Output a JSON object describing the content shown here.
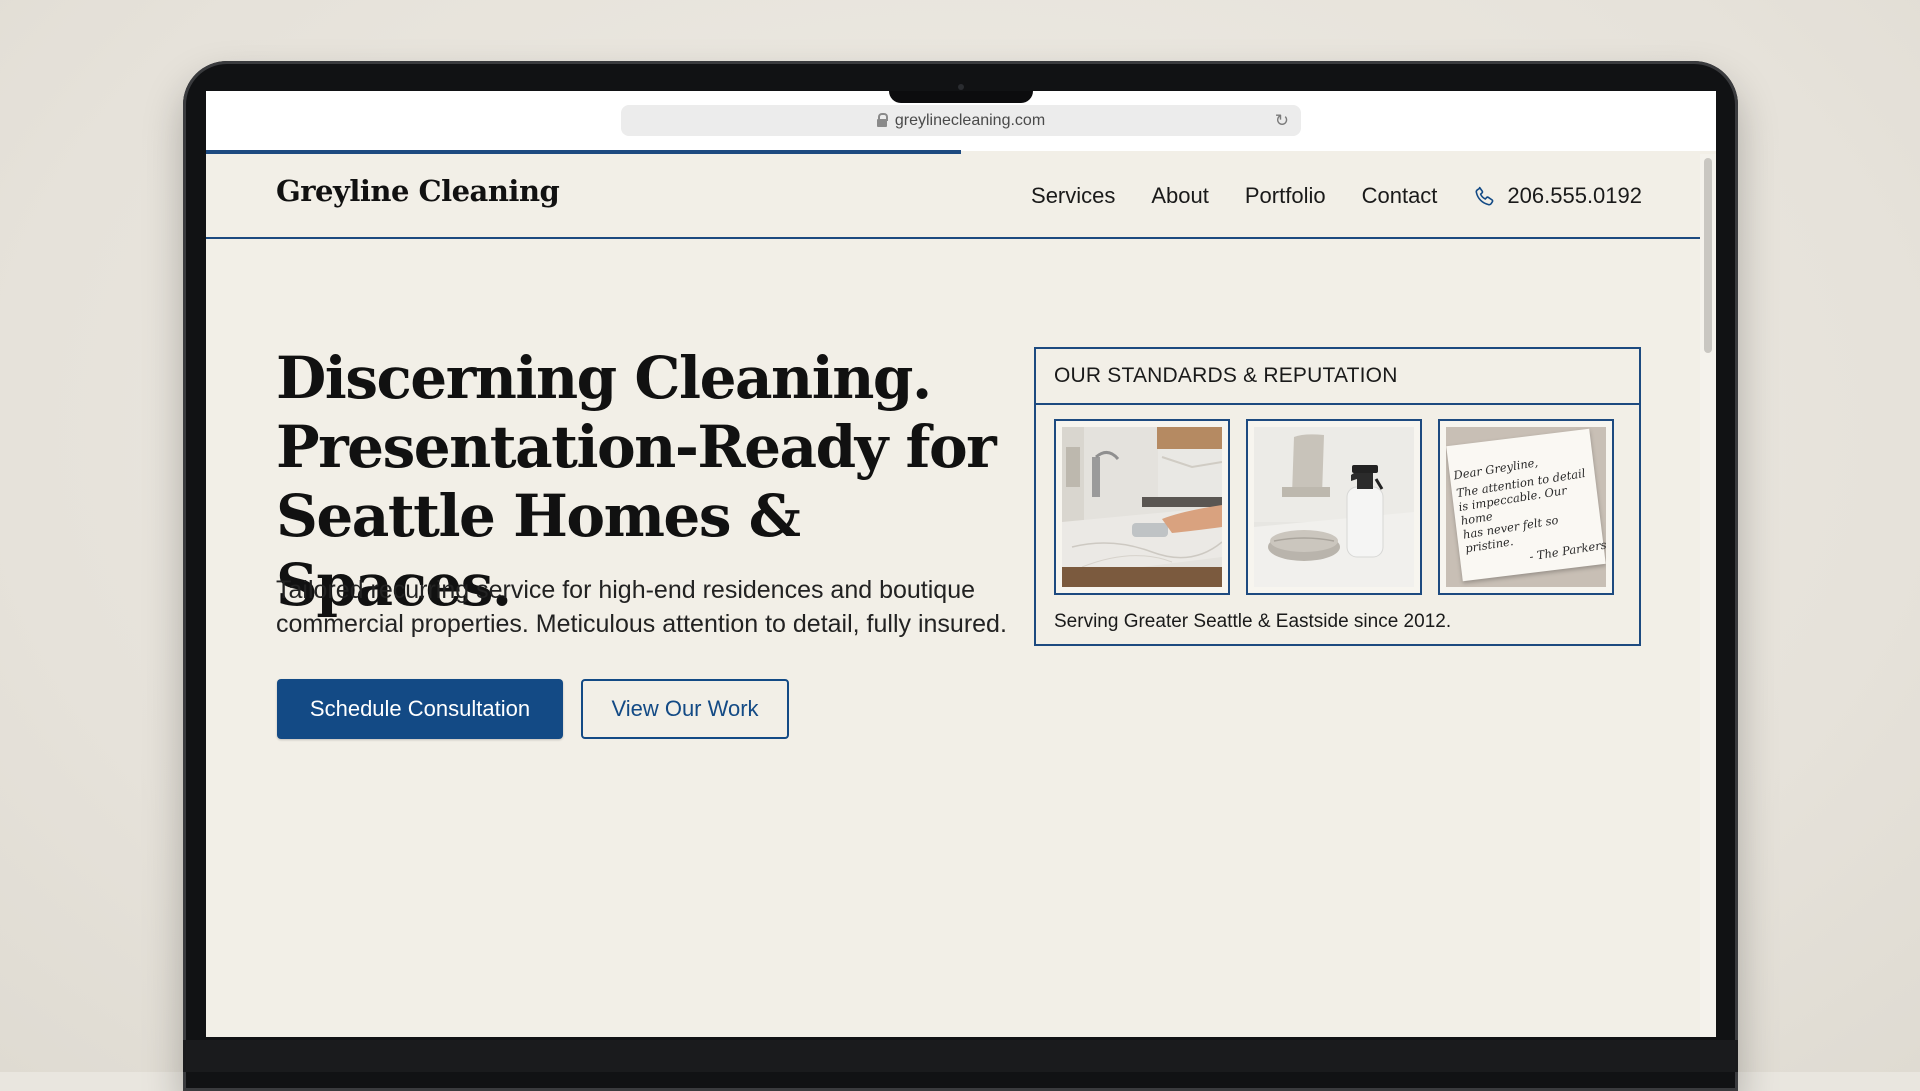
{
  "browser": {
    "url": "greylinecleaning.com",
    "load_progress_fraction": 0.5
  },
  "header": {
    "brand": "Greyline Cleaning",
    "nav": [
      "Services",
      "About",
      "Portfolio",
      "Contact"
    ],
    "phone": "206.555.0192"
  },
  "hero": {
    "title_lines": [
      "Discerning Cleaning.",
      "Presentation-Ready for",
      "Seattle Homes & Spaces."
    ],
    "subtitle_lines": [
      "Tailored recurring service for high-end residences and boutique",
      "commercial properties. Meticulous attention to detail, fully insured."
    ],
    "primary_button": "Schedule Consultation",
    "secondary_button": "View Our Work"
  },
  "standards": {
    "heading": "OUR STANDARDS & REPUTATION",
    "caption": "Serving Greater Seattle & Eastside since 2012.",
    "note_lines": [
      "Dear Greyline,",
      "The attention to detail",
      "is impeccable. Our home",
      "has never felt so pristine.",
      "- The Parkers"
    ]
  },
  "colors": {
    "accent": "#134a85",
    "page_background": "#f2efe7"
  }
}
